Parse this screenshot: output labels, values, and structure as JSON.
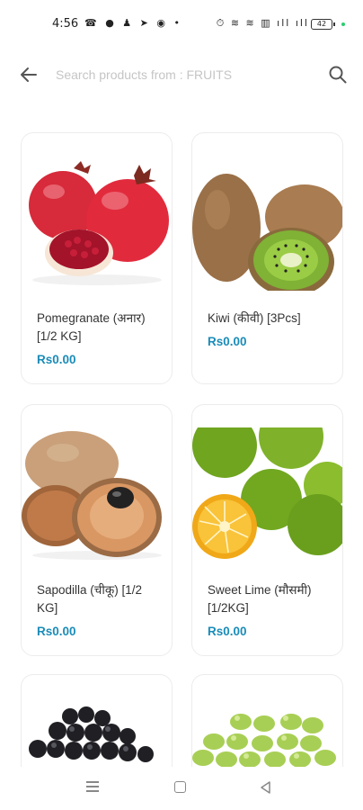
{
  "status_bar": {
    "time": "4:56",
    "left_icons": "☎ ● ♟ ➤ ◉ •",
    "right_icons": "⏱ ≋ ≋ ▥ ıll ıll",
    "battery": "42"
  },
  "search": {
    "placeholder": "Search products from : FRUITS",
    "value": ""
  },
  "products": [
    {
      "name": "Pomegranate (अनार) [1/2 KG]",
      "price": "Rs0.00",
      "image": "pomegranate"
    },
    {
      "name": "Kiwi (कीवी) [3Pcs]",
      "price": "Rs0.00",
      "image": "kiwi"
    },
    {
      "name": "Sapodilla (चीकू) [1/2 KG]",
      "price": "Rs0.00",
      "image": "sapodilla"
    },
    {
      "name": "Sweet Lime (मौसमी) [1/2KG]",
      "price": "Rs0.00",
      "image": "sweet-lime"
    },
    {
      "name": "",
      "price": "",
      "image": "black-grapes"
    },
    {
      "name": "",
      "price": "",
      "image": "green-grapes"
    }
  ],
  "colors": {
    "price": "#1a8cb8",
    "card_border": "#ececec",
    "placeholder": "#c5c5c5"
  }
}
